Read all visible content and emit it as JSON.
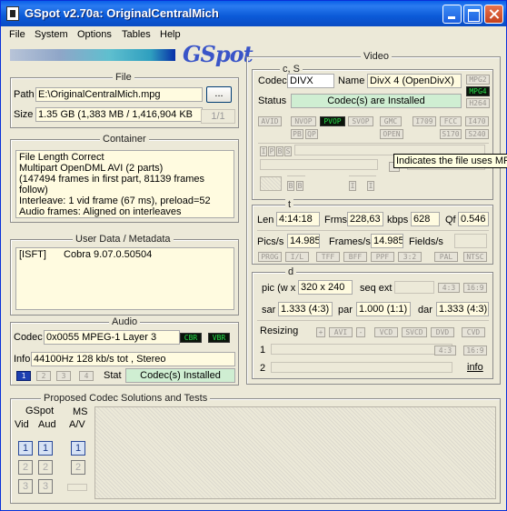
{
  "window": {
    "title": "GSpot v2.70a: OriginalCentralMich"
  },
  "menu": [
    "File",
    "System",
    "Options",
    "Tables",
    "Help"
  ],
  "logo": "GSpot",
  "file": {
    "legend": "File",
    "path_label": "Path",
    "path_value": "E:\\OriginalCentralMich.mpg",
    "browse_label": "...",
    "size_label": "Size",
    "size_value": "1.35 GB (1,383 MB / 1,416,904 KB",
    "part_label": "1/1"
  },
  "container": {
    "legend": "Container",
    "lines": [
      "File Length Correct",
      "Multipart OpenDML AVI (2 parts)",
      "(147494 frames in first part, 81139 frames follow)",
      "Interleave: 1 vid frame (67 ms), preload=52",
      "Audio frames: Aligned on interleaves"
    ]
  },
  "metadata": {
    "legend": "User Data / Metadata",
    "tag": "[ISFT]",
    "value": "Cobra 9.07.0.50504"
  },
  "audio": {
    "legend": "Audio",
    "codec_label": "Codec",
    "codec_value": "0x0055 MPEG-1 Layer 3",
    "cbr": "CBR",
    "vbr": "VBR",
    "info_label": "Info",
    "info_value": "44100Hz  128 kb/s tot , Stereo",
    "stream_buttons": [
      "1",
      "2",
      "3",
      "4"
    ],
    "stat_label": "Stat",
    "stat_value": "Codec(s) Installed"
  },
  "video": {
    "legend": "Video",
    "cs_legend": "c, S",
    "codec_label": "Codec",
    "codec_value": "DIVX",
    "name_label": "Name",
    "name_value": "DivX 4 (OpenDivX)",
    "status_label": "Status",
    "status_value": "Codec(s) are Installed",
    "side_badges": [
      {
        "label": "MPG2",
        "on": false
      },
      {
        "label": "MPG4",
        "on": true
      },
      {
        "label": "H264",
        "on": false
      }
    ],
    "badges_row1": [
      {
        "label": "AVID",
        "on": false
      },
      {
        "label": "NVOP",
        "on": false
      },
      {
        "label": "PVOP",
        "on": true
      },
      {
        "label": "SVOP",
        "on": false
      },
      {
        "label": "GMC",
        "on": false
      },
      {
        "label": "I709",
        "on": false
      },
      {
        "label": "FCC",
        "on": false
      },
      {
        "label": "I470",
        "on": false
      }
    ],
    "badges_row2": [
      {
        "label": "PB",
        "on": false
      },
      {
        "label": "QP",
        "on": false
      },
      {
        "label": "OPEN",
        "on": false
      },
      {
        "label": "S170",
        "on": false
      },
      {
        "label": "S240",
        "on": false
      }
    ],
    "frame_types": [
      "I",
      "P",
      "B",
      "S"
    ],
    "bb_labels": [
      "B",
      "B",
      "I",
      "I"
    ],
    "tooltip": "Indicates the file uses MPEG-4",
    "t_legend": "t",
    "len_label": "Len",
    "len_value": "4:14:18",
    "frms_label": "Frms",
    "frms_value": "228,63",
    "kbps_label": "kbps",
    "kbps_value": "628",
    "qf_label": "Qf",
    "qf_value": "0.546",
    "pics_label": "Pics/s",
    "pics_value": "14.985",
    "frames_label": "Frames/s",
    "frames_value": "14.985",
    "fields_label": "Fields/s",
    "t_badges": [
      "PROG",
      "I/L",
      "TFF",
      "BFF",
      "PPF",
      "3:2",
      "PAL",
      "NTSC"
    ],
    "d_legend": "d",
    "pic_label": "pic (w x",
    "pic_value": "320 x 240",
    "seqext_label": "seq ext",
    "aspect_badges": [
      "4:3",
      "16:9"
    ],
    "sar_label": "sar",
    "sar_value": "1.333 (4:3)",
    "par_label": "par",
    "par_value": "1.000 (1:1)",
    "dar_label": "dar",
    "dar_value": "1.333 (4:3)",
    "resizing_label": "Resizing",
    "resize_badges": [
      "+",
      "AVI",
      "-",
      "VCD",
      "SVCD",
      "DVD",
      "CVD"
    ],
    "row1_label": "1",
    "row2_label": "2",
    "aspect2": [
      "4:3",
      "16:9"
    ],
    "info_link": "info"
  },
  "proposed": {
    "legend": "Proposed Codec Solutions and Tests",
    "gspot_label": "GSpot",
    "vid_label": "Vid",
    "aud_label": "Aud",
    "ms_label": "MS",
    "av_label": "A/V",
    "buttons": [
      "1",
      "2",
      "3"
    ]
  }
}
